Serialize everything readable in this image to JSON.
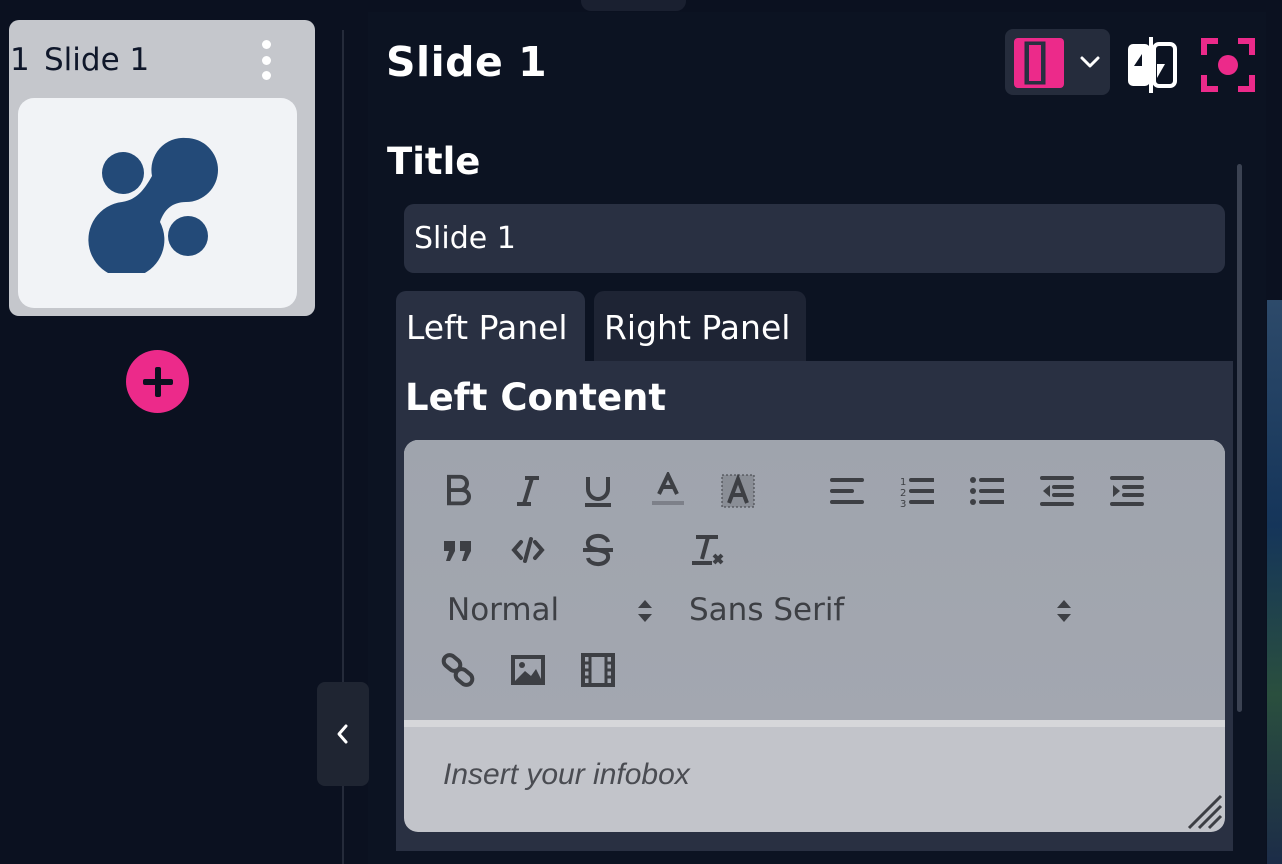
{
  "sidebar": {
    "slides": [
      {
        "number": "1",
        "name": "Slide 1",
        "menu_icon": "kebab-menu-icon",
        "thumbnail_icon": "logo-icon"
      }
    ],
    "add_slide_icon": "plus-icon",
    "collapse_icon": "chevron-left-icon"
  },
  "header": {
    "title": "Slide 1",
    "layout_icon": "two-panel-layout-icon",
    "dropdown_icon": "chevron-down-icon",
    "swap_icon": "swap-panels-icon",
    "focus_icon": "focus-target-icon"
  },
  "form": {
    "title_label": "Title",
    "title_value": "Slide 1",
    "tabs": [
      {
        "label": "Left Panel",
        "active": true
      },
      {
        "label": "Right Panel",
        "active": false
      }
    ],
    "content_label": "Left Content"
  },
  "editor": {
    "toolbar": {
      "row1": [
        "bold-icon",
        "italic-icon",
        "underline-icon",
        "text-color-icon",
        "background-color-icon",
        "align-left-icon",
        "ordered-list-icon",
        "bullet-list-icon",
        "outdent-icon",
        "indent-icon"
      ],
      "row2": [
        "blockquote-icon",
        "code-icon",
        "strikethrough-icon",
        "clear-format-icon"
      ],
      "header_select": "Normal",
      "font_select": "Sans Serif",
      "row4": [
        "link-icon",
        "image-icon",
        "video-icon"
      ]
    },
    "placeholder": "Insert your infobox"
  },
  "colors": {
    "accent": "#ec2a8a",
    "background": "#0b1120",
    "panel": "#293042",
    "logo": "#234a78"
  }
}
